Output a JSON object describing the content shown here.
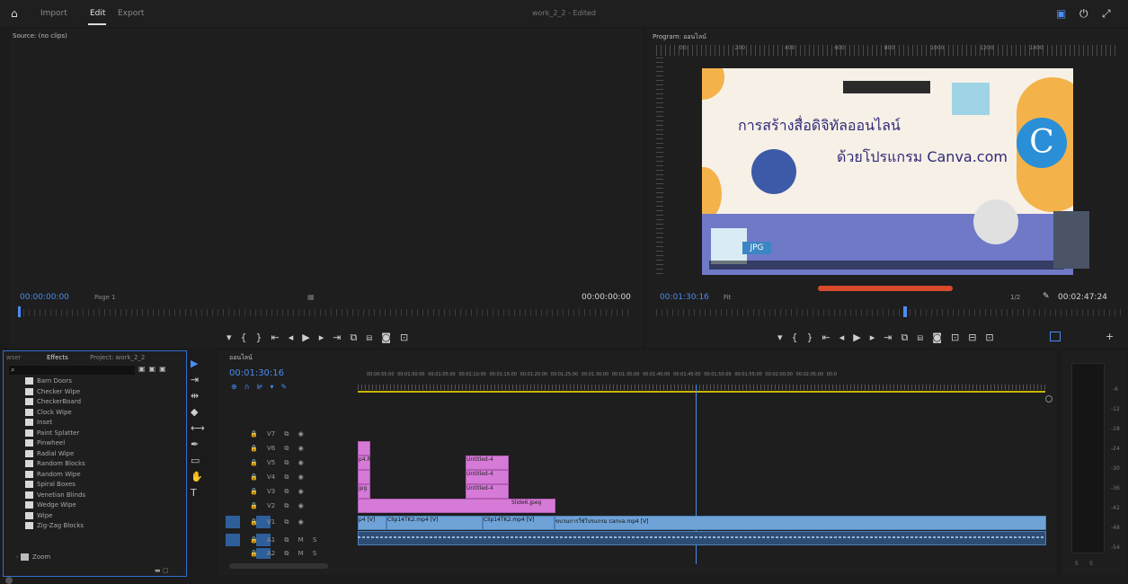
{
  "workspace": {
    "import": "Import",
    "edit": "Edit",
    "export": "Export",
    "title": "work_2_2 - Edited"
  },
  "source": {
    "title": "Source: (no clips)",
    "timecode_left": "00:00:00:00",
    "page": "Page 1",
    "timecode_right": "00:00:00:00"
  },
  "program": {
    "title": "Program: ออนไลน์",
    "ruler_ticks": [
      "00:",
      "200",
      "400",
      "600",
      "800",
      "1000",
      "1200",
      "1400"
    ],
    "timecode": "00:01:30:16",
    "fit": "Fit",
    "fraction": "1/2",
    "duration": "00:02:47:24",
    "slide": {
      "line1": "การสร้างสื่อดิจิทัลออนไลน์",
      "line2": "ด้วยโปรแกรม Canva.com",
      "jpg": "JPG",
      "logo": "C"
    }
  },
  "effects": {
    "tabs": {
      "left": "wser",
      "effects": "Effects",
      "project": "Project: work_2_2"
    },
    "items": [
      "Barn Doors",
      "Checker Wipe",
      "CheckerBoard",
      "Clock Wipe",
      "Inset",
      "Paint Splatter",
      "Pinwheel",
      "Radial Wipe",
      "Random Blocks",
      "Random Wipe",
      "Spiral Boxes",
      "Venetian Blinds",
      "Wedge Wipe",
      "Wipe",
      "Zig-Zag Blocks"
    ],
    "folder": "Zoom"
  },
  "timeline": {
    "title": "ออนไลน์",
    "timecode": "00:01:30:16",
    "ruler": [
      "00:00:55:00",
      "00:01:00:00",
      "00:01:05:00",
      "00:01:10:00",
      "00:01:15:00",
      "00:01:20:00",
      "00:01:25:00",
      "00:01:30:00",
      "00:01:35:00",
      "00:01:40:00",
      "00:01:45:00",
      "00:01:50:00",
      "00:01:55:00",
      "00:02:00:00",
      "00:02:05:00",
      "00:0"
    ],
    "tracks": {
      "v7": "V7",
      "v6": "V6",
      "v5": "V5",
      "v4": "V4",
      "v3": "V3",
      "v2": "V2",
      "v1": "V1",
      "a1": "A1",
      "a2": "A2"
    },
    "clips": {
      "untitled4a": "Untitled-4",
      "untitled4b": "Untitled-4",
      "untitled4c": "Untitled-4",
      "slide6": "Slide6.jpeg",
      "v1a": "p4 [V]",
      "v1b": "Clip14TK2.mp4 [V]",
      "v1c": "Clip14TK2.mp4 [V]",
      "v1d": "ขบวนการใช้โปรแกรม canva.mp4 [V]",
      "v5frag": "p4.R",
      "v3frag": "jpg"
    }
  },
  "meter": {
    "labels": [
      "-6",
      "-12",
      "-18",
      "-24",
      "-30",
      "-36",
      "-42",
      "-48",
      "-54"
    ],
    "bottom_left": "S",
    "bottom_right": "S"
  }
}
